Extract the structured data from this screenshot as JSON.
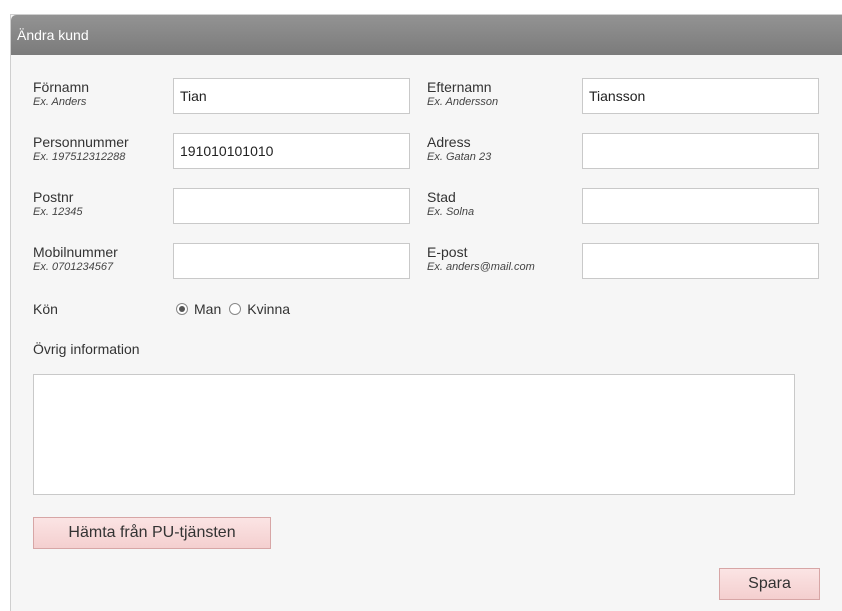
{
  "panel": {
    "title": "Ändra kund"
  },
  "form": {
    "firstname": {
      "label": "Förnamn",
      "example": "Ex. Anders",
      "value": "Tian"
    },
    "lastname": {
      "label": "Efternamn",
      "example": "Ex. Andersson",
      "value": "Tiansson"
    },
    "personnummer": {
      "label": "Personnummer",
      "example": "Ex. 197512312288",
      "value": "191010101010"
    },
    "address": {
      "label": "Adress",
      "example": "Ex. Gatan 23",
      "value": ""
    },
    "postnr": {
      "label": "Postnr",
      "example": "Ex. 12345",
      "value": ""
    },
    "city": {
      "label": "Stad",
      "example": "Ex. Solna",
      "value": ""
    },
    "mobile": {
      "label": "Mobilnummer",
      "example": "Ex. 0701234567",
      "value": ""
    },
    "email": {
      "label": "E-post",
      "example": "Ex. anders@mail.com",
      "value": ""
    },
    "gender": {
      "label": "Kön",
      "options": [
        "Man",
        "Kvinna"
      ],
      "selected": "Man"
    },
    "other_info": {
      "label": "Övrig information",
      "value": ""
    }
  },
  "buttons": {
    "fetch": "Hämta från PU-tjänsten",
    "save": "Spara"
  }
}
